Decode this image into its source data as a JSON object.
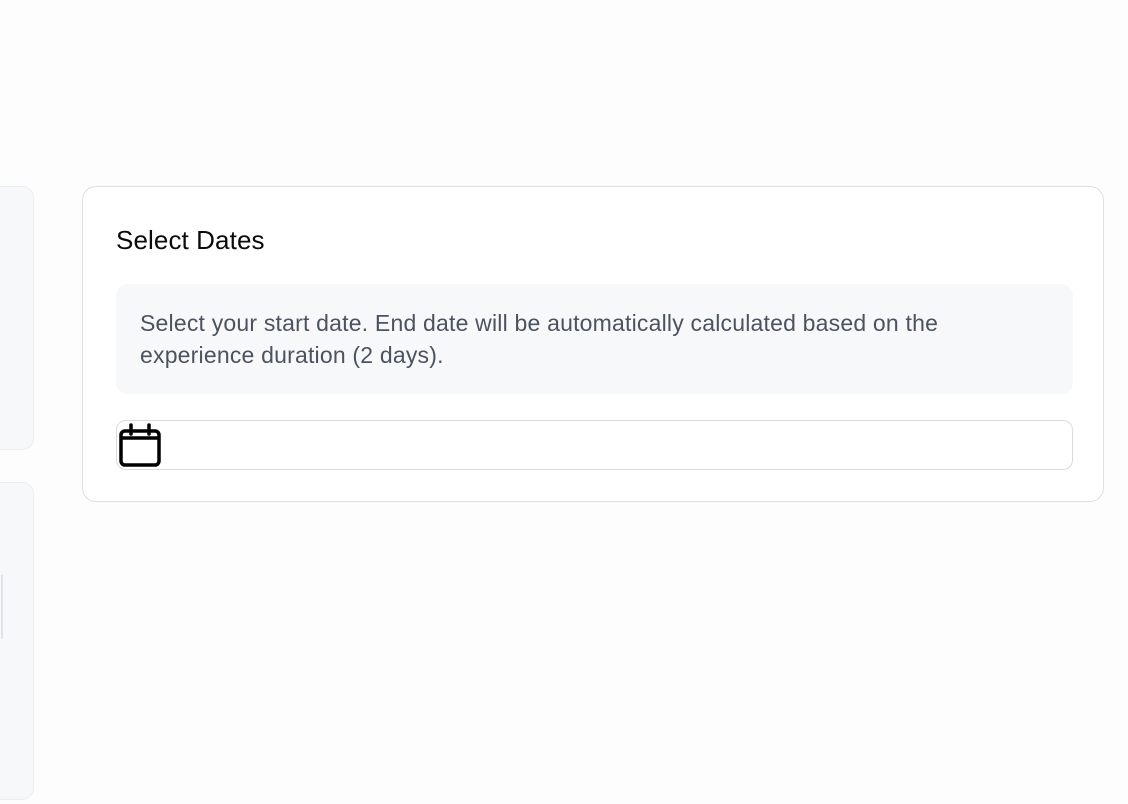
{
  "card": {
    "title": "Select Dates",
    "info_text": "Select your start date. End date will be automatically calculated based on the experience duration (2 days)."
  },
  "date_input": {
    "icon": "calendar-icon",
    "value": ""
  },
  "colors": {
    "card_border": "#dedfe2",
    "info_bg": "#f7f8fa",
    "info_text": "#4b5360",
    "title_text": "#0b0b0d"
  }
}
